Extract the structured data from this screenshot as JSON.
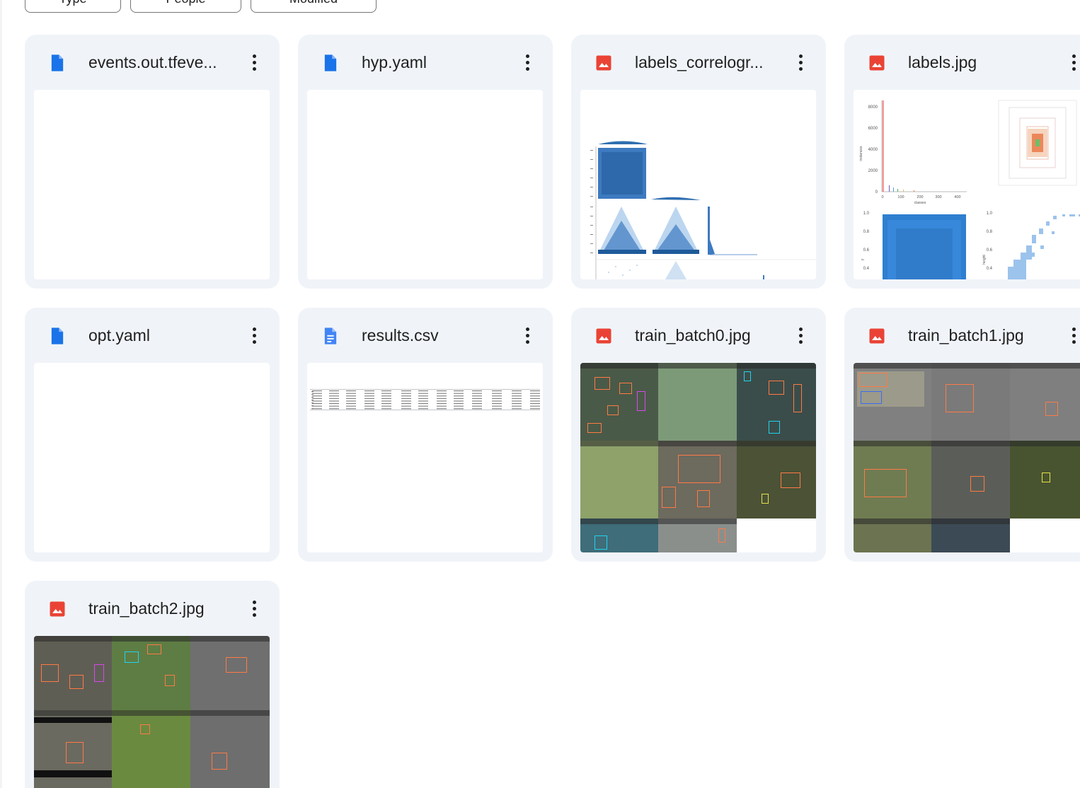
{
  "filters": [
    {
      "label": "Type"
    },
    {
      "label": "People"
    },
    {
      "label": "Modified"
    }
  ],
  "files": [
    {
      "name": "events.out.tfeve...",
      "kind": "doc",
      "thumb": "blank"
    },
    {
      "name": "hyp.yaml",
      "kind": "doc",
      "thumb": "blank"
    },
    {
      "name": "labels_correlogr...",
      "kind": "image",
      "thumb": "correlogram"
    },
    {
      "name": "labels.jpg",
      "kind": "image",
      "thumb": "labels"
    },
    {
      "name": "opt.yaml",
      "kind": "doc",
      "thumb": "blank"
    },
    {
      "name": "results.csv",
      "kind": "sheet",
      "thumb": "table"
    },
    {
      "name": "train_batch0.jpg",
      "kind": "image",
      "thumb": "batch"
    },
    {
      "name": "train_batch1.jpg",
      "kind": "image",
      "thumb": "batch"
    },
    {
      "name": "train_batch2.jpg",
      "kind": "image",
      "thumb": "batch"
    }
  ],
  "labels_plot": {
    "ylabel": "instances",
    "xlabel": "classes",
    "y_ticks": [
      "8000",
      "6000",
      "4000",
      "2000",
      "0"
    ],
    "x_ticks": [
      "0",
      "100",
      "200",
      "300",
      "400"
    ],
    "lower_left_ticks": [
      "1.0",
      "0.8",
      "0.6",
      "0.4"
    ],
    "lower_left_ylabel": "y",
    "lower_right_ticks": [
      "1.0",
      "0.8",
      "0.6",
      "0.4"
    ],
    "lower_right_ylabel": "height"
  },
  "colors": {
    "card_bg": "#f0f4f9",
    "doc_icon": "#1a73e8",
    "image_icon": "#ea4335",
    "text": "#1f1f1f"
  }
}
